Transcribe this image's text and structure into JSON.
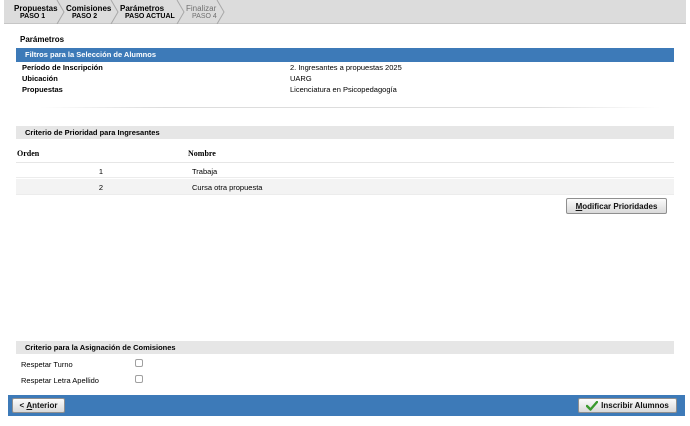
{
  "wizard": {
    "steps": [
      {
        "title": "Propuestas",
        "sub": "PASO 1"
      },
      {
        "title": "Comisiones",
        "sub": "PASO 2"
      },
      {
        "title": "Parámetros",
        "sub": "PASO ACTUAL"
      },
      {
        "title": "Finalizar",
        "sub": "PASO 4"
      }
    ]
  },
  "section_title": "Parámetros",
  "filtros": {
    "header": "Filtros para la Selección de Alumnos",
    "rows": [
      {
        "label": "Período de Inscripción",
        "value": "2. Ingresantes a propuestas 2025"
      },
      {
        "label": "Ubicación",
        "value": "UARG"
      },
      {
        "label": "Propuestas",
        "value": "Licenciatura en Psicopedagogía"
      }
    ]
  },
  "prioridad": {
    "header": "Criterio de Prioridad para Ingresantes",
    "col_orden": "Orden",
    "col_nombre": "Nombre",
    "rows": [
      {
        "orden": "1",
        "nombre": "Trabaja"
      },
      {
        "orden": "2",
        "nombre": "Cursa otra propuesta"
      }
    ],
    "modificar_hotkey": "M",
    "modificar_rest": "odificar Prioridades"
  },
  "comisiones": {
    "header": "Criterio para la Asignación de Comisiones",
    "options": [
      {
        "label": "Respetar Turno",
        "checked": false
      },
      {
        "label": "Respetar Letra Apellido",
        "checked": false
      }
    ]
  },
  "footer": {
    "anterior_prefix": "< ",
    "anterior_hotkey": "A",
    "anterior_rest": "nterior",
    "inscribir_label": "Inscribir Alumnos"
  },
  "colors": {
    "accent": "#3d7ab8",
    "check_green": "#3a9a2e"
  }
}
